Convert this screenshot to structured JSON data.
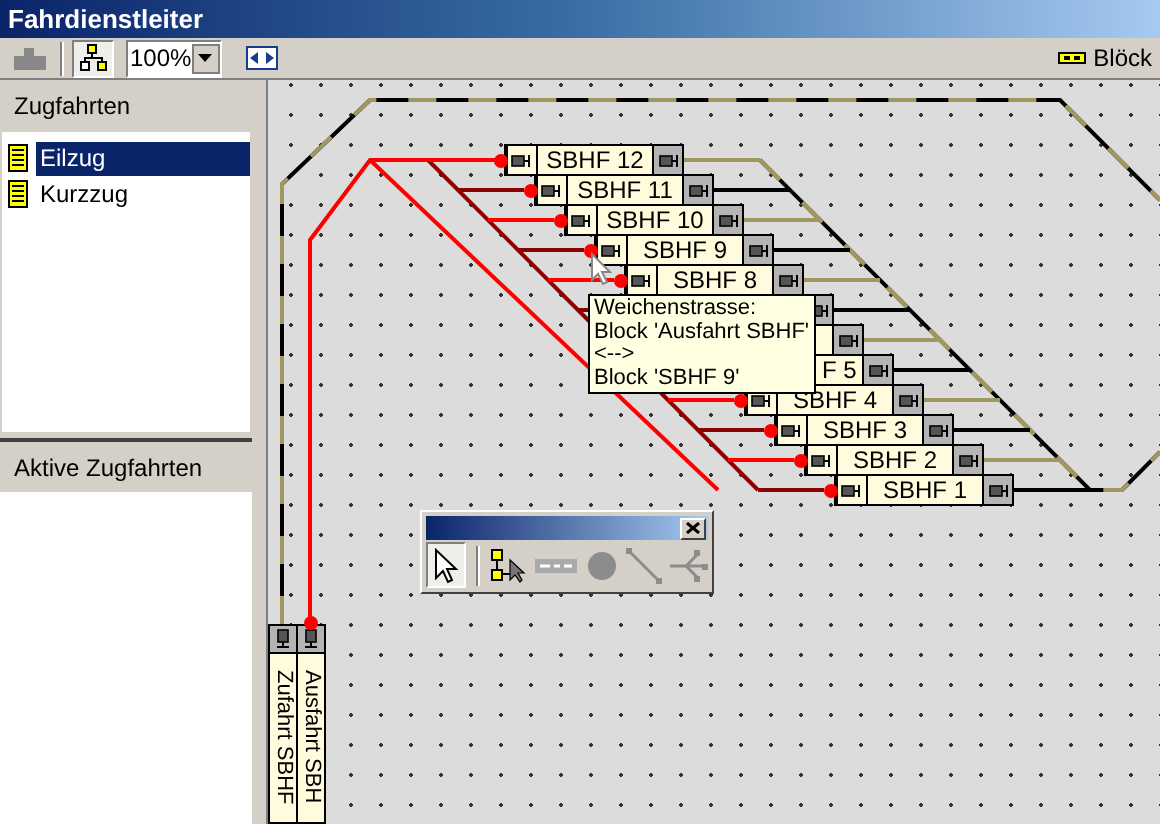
{
  "window": {
    "title": "Fahrdienstleiter"
  },
  "toolbar": {
    "zoom": "100%",
    "blocks_label": "Blöck"
  },
  "train_runs": {
    "title": "Zugfahrten",
    "items": [
      {
        "label": "Eilzug",
        "selected": true
      },
      {
        "label": "Kurzzug",
        "selected": false
      }
    ]
  },
  "active_train_runs": {
    "title": "Aktive Zugfahrten"
  },
  "canvas": {
    "blocks": [
      {
        "kind": "full",
        "label": "SBHF 12"
      },
      {
        "kind": "full",
        "label": "SBHF 11"
      },
      {
        "kind": "full",
        "label": "SBHF 10"
      },
      {
        "kind": "full",
        "label": "SBHF 9"
      },
      {
        "kind": "full",
        "label": "SBHF 8"
      },
      {
        "kind": "hidden"
      },
      {
        "kind": "hidden"
      },
      {
        "kind": "partial",
        "label": "F 5"
      },
      {
        "kind": "full",
        "label": "SBHF 4"
      },
      {
        "kind": "full",
        "label": "SBHF 3"
      },
      {
        "kind": "full",
        "label": "SBHF 2"
      },
      {
        "kind": "full",
        "label": "SBHF 1"
      }
    ],
    "vertical_blocks": [
      {
        "label": "Zufahrt SBHF",
        "route": false
      },
      {
        "label": "Ausfahrt SBH",
        "route": true
      }
    ],
    "tooltip": {
      "lines": [
        "Weichenstrasse:",
        "Block 'Ausfahrt SBHF'",
        "<-->",
        "Block 'SBHF 9'"
      ]
    }
  },
  "palette": {
    "tools": [
      {
        "kind": "pointer",
        "selected": true
      },
      {
        "kind": "tree",
        "selected": false
      },
      {
        "kind": "block",
        "selected": false
      },
      {
        "kind": "circle",
        "selected": false
      },
      {
        "kind": "line",
        "selected": false
      },
      {
        "kind": "turnout",
        "selected": false
      }
    ]
  }
}
